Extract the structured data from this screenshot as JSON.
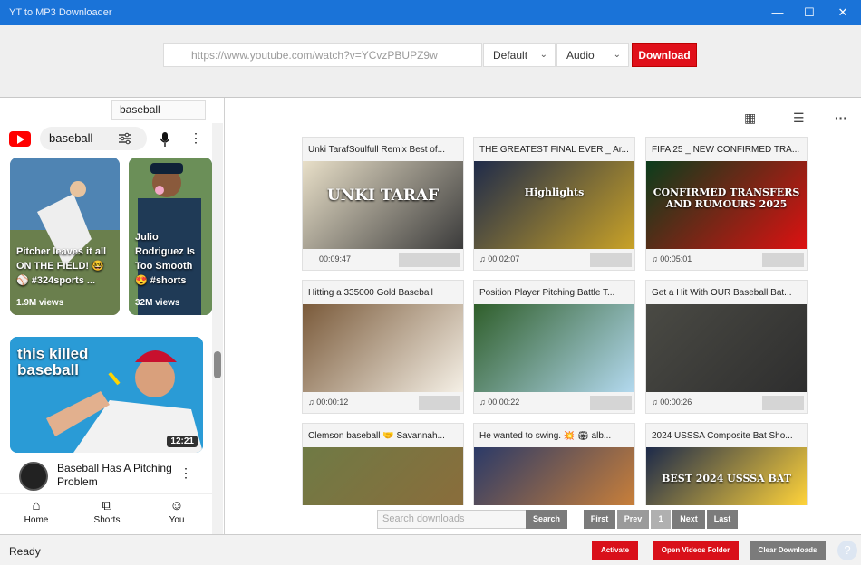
{
  "window": {
    "title": "YT to MP3 Downloader",
    "minimize": "—",
    "maximize": "☐",
    "close": "✕"
  },
  "toolbar": {
    "url_placeholder": "https://www.youtube.com/watch?v=YCvzPBUPZ9w",
    "quality": "Default",
    "format": "Audio",
    "download_label": "Download",
    "accent": "#e0101a"
  },
  "browser": {
    "search_chip": "baseball",
    "youtube_search": "baseball",
    "shorts": [
      {
        "caption": "Pitcher leaves it all ON THE FIELD! 🤓 ⚾ #324sports ...",
        "views": "1.9M views"
      },
      {
        "caption": "Julio Rodriguez Is Too Smooth 😍 #shorts",
        "views": "32M views"
      }
    ],
    "video": {
      "headline": "this killed baseball",
      "duration": "12:21",
      "title": "Baseball Has A Pitching Problem"
    },
    "nav": {
      "home": "Home",
      "shorts": "Shorts",
      "you": "You"
    }
  },
  "downloads": {
    "items": [
      {
        "title": "Unki TarafSoulfull Remix Best of...",
        "duration": "00:09:47",
        "thumb_text": "UNKI TARAF"
      },
      {
        "title": "THE GREATEST FINAL EVER _ Ar...",
        "duration": "00:02:07",
        "thumb_text": "Highlights"
      },
      {
        "title": "FIFA 25 _ NEW CONFIRMED TRA...",
        "duration": "00:05:01",
        "thumb_text": "CONFIRMED TRANSFERS AND RUMOURS 2025"
      },
      {
        "title": "Hitting a 335000 Gold Baseball",
        "duration": "00:00:12",
        "thumb_text": ""
      },
      {
        "title": "Position Player Pitching Battle T...",
        "duration": "00:00:22",
        "thumb_text": ""
      },
      {
        "title": "Get a Hit With OUR Baseball Bat...",
        "duration": "00:00:26",
        "thumb_text": ""
      },
      {
        "title": "Clemson baseball 🤝 Savannah...",
        "duration": "",
        "thumb_text": ""
      },
      {
        "title": "He wanted to swing. 💥 🏟 alb...",
        "duration": "",
        "thumb_text": ""
      },
      {
        "title": "2024 USSSA Composite Bat Sho...",
        "duration": "",
        "thumb_text": "BEST 2024 USSSA BAT"
      }
    ],
    "search_placeholder": "Search downloads",
    "search_label": "Search",
    "pager": {
      "first": "First",
      "prev": "Prev",
      "page": "1",
      "next": "Next",
      "last": "Last"
    }
  },
  "status": {
    "text": "Ready",
    "activate": "Activate",
    "open_folder": "Open Videos Folder",
    "clear": "Clear Downloads",
    "help": "?"
  }
}
